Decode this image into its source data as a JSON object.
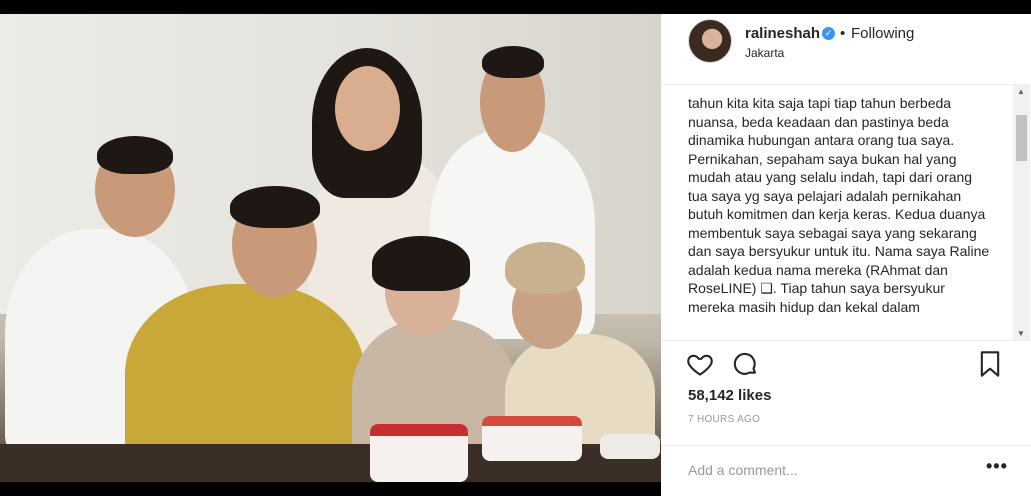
{
  "post": {
    "username": "ralineshah",
    "follow_status": "Following",
    "separator": "•",
    "location": "Jakarta",
    "verified": true
  },
  "caption": {
    "text": "tahun kita kita saja tapi tiap tahun berbeda nuansa, beda keadaan dan pastinya beda dinamika hubungan antara orang tua saya. Pernikahan, sepaham saya bukan hal yang mudah atau yang selalu indah, tapi dari orang tua saya yg saya pelajari adalah pernikahan butuh komitmen dan kerja keras. Kedua duanya membentuk saya sebagai saya yang sekarang dan saya bersyukur untuk itu. Nama saya Raline adalah kedua nama mereka (RAhmat dan RoseLINE) ❑. Tiap tahun saya bersyukur mereka masih hidup dan kekal dalam"
  },
  "stats": {
    "likes": "58,142 likes",
    "time": "7 HOURS AGO"
  },
  "comment": {
    "placeholder": "Add a comment...",
    "more": "•••"
  },
  "icons": {
    "like": "heart-icon",
    "comment": "comment-bubble-icon",
    "save": "bookmark-icon",
    "verified": "verified-badge-icon"
  },
  "colors": {
    "verified": "#3897f0",
    "text": "#262626",
    "muted": "#999999"
  }
}
